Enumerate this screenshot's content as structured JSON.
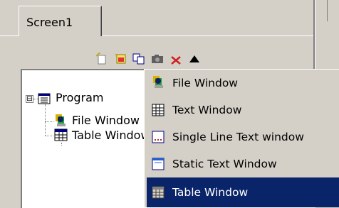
{
  "tabs": [
    {
      "label": "Screen1"
    }
  ],
  "toolbar": {
    "buttons": [
      {
        "icon": "new-item-icon"
      },
      {
        "icon": "add-window-icon"
      },
      {
        "icon": "copy-icon"
      },
      {
        "icon": "camera-icon"
      },
      {
        "icon": "delete-icon"
      },
      {
        "icon": "move-up-icon"
      },
      {
        "icon": "moon-icon"
      }
    ]
  },
  "tree": {
    "root": {
      "label": "Program",
      "expander": "⊟"
    },
    "children": [
      {
        "label": "File Window"
      },
      {
        "label": "Table Window"
      }
    ]
  },
  "context_menu": {
    "items": [
      {
        "label": "File Window",
        "icon": "file-window-icon",
        "selected": false
      },
      {
        "label": "Text Window",
        "icon": "text-window-icon",
        "selected": false
      },
      {
        "label": "Single Line Text window",
        "icon": "single-line-text-window-icon",
        "selected": false
      },
      {
        "label": "Static Text Window",
        "icon": "static-text-window-icon",
        "selected": false
      },
      {
        "label": "Table Window",
        "icon": "table-window-icon",
        "selected": true
      }
    ]
  },
  "colors": {
    "face": "#d4d0c8",
    "selection": "#0a246a",
    "white": "#ffffff"
  }
}
